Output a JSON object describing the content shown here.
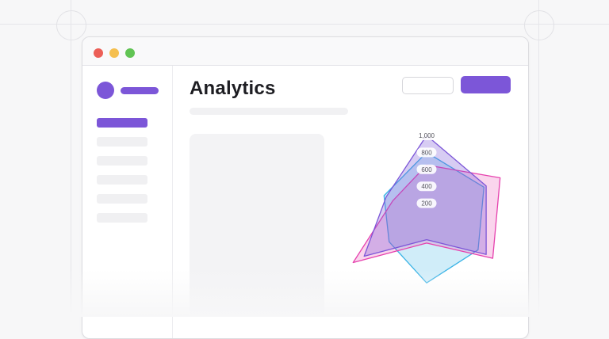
{
  "window": {
    "controls": [
      "close",
      "minimize",
      "zoom"
    ],
    "colors": {
      "close": "#ec5f57",
      "minimize": "#f5bf4f",
      "zoom": "#61c454"
    }
  },
  "header": {
    "title": "Analytics"
  },
  "colors": {
    "accent": "#7c56d8",
    "series_purple": "#7c56d8",
    "series_pink": "#e642ae",
    "series_blue": "#39b3e6"
  },
  "chart_data": {
    "type": "radar",
    "axis": {
      "ticks": [
        200,
        400,
        600,
        800,
        1000
      ],
      "tick_labels": [
        "200",
        "400",
        "600",
        "800",
        "1,000"
      ],
      "max": 1000
    },
    "series": [
      {
        "values": [
          1000,
          810,
          810,
          230,
          850,
          550
        ]
      },
      {
        "values": [
          650,
          1000,
          900,
          270,
          1000,
          460
        ]
      },
      {
        "values": [
          800,
          780,
          700,
          740,
          510,
          580
        ]
      }
    ]
  }
}
